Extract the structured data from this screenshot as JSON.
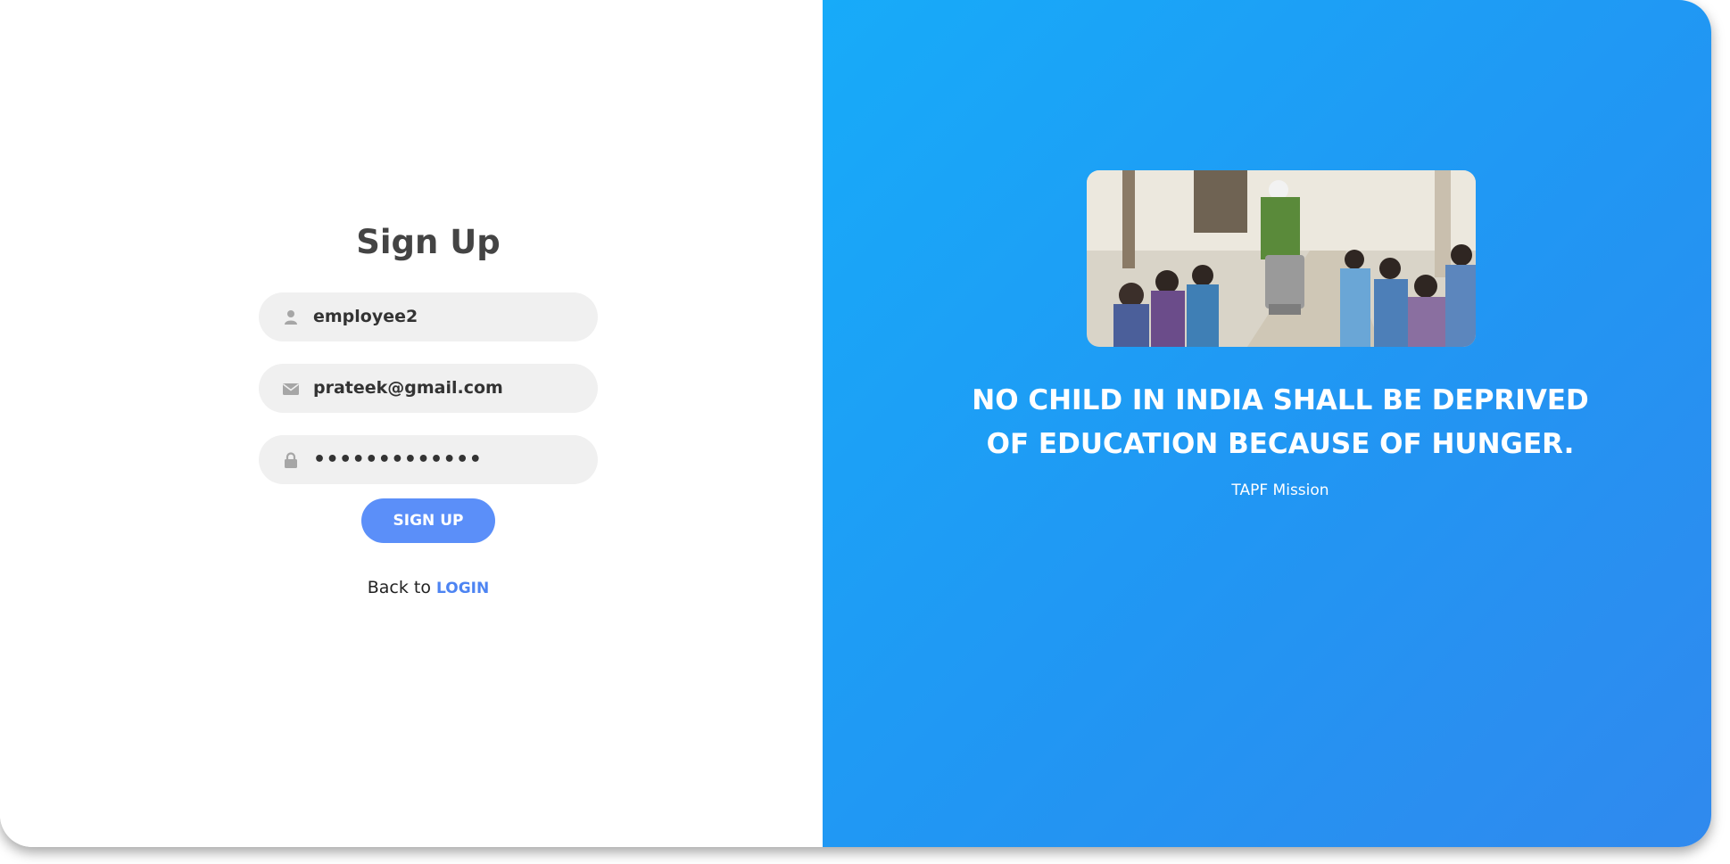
{
  "signup": {
    "title": "Sign Up",
    "username": {
      "value": "employee2",
      "icon": "user-icon"
    },
    "email": {
      "value": "prateek@gmail.com",
      "icon": "envelope-icon"
    },
    "password": {
      "value": "•••••••••••••",
      "icon": "lock-icon"
    },
    "button_label": "SIGN UP",
    "back_text": "Back to",
    "login_link": "LOGIN"
  },
  "panel": {
    "quote_line1": "NO CHILD IN INDIA SHALL BE DEPRIVED",
    "quote_line2": "OF EDUCATION BECAUSE OF HUNGER.",
    "caption": "TAPF Mission",
    "image": "children-midday-meal-photo"
  },
  "colors": {
    "accent": "#5b8ff9",
    "panel_gradient_start": "#17abf9",
    "panel_gradient_end": "#3089ee",
    "field_bg": "#f0f0f0"
  }
}
